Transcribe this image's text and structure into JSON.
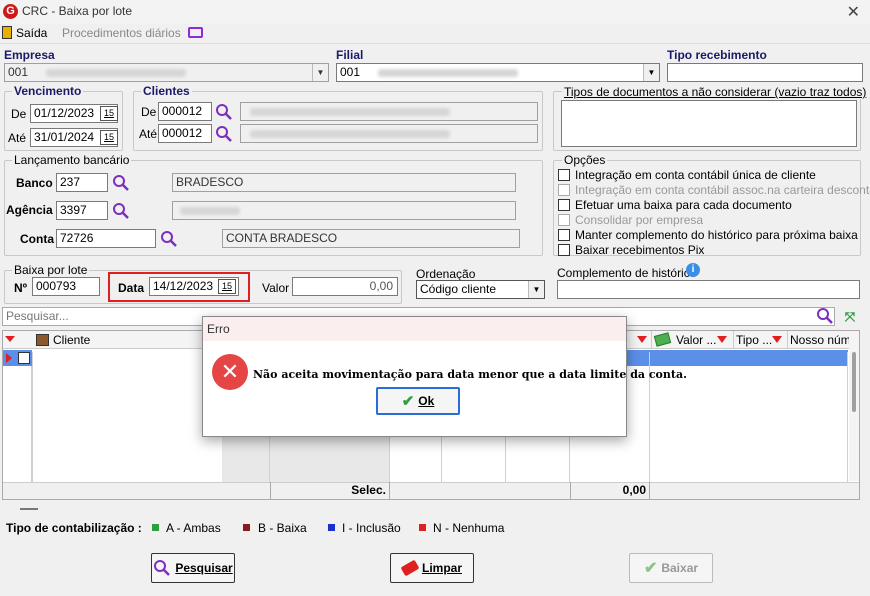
{
  "window": {
    "title": "CRC - Baixa por lote"
  },
  "toolbar": {
    "exit": "Saída",
    "daily": "Procedimentos diários"
  },
  "empresa": {
    "label": "Empresa",
    "value": "001"
  },
  "filial": {
    "label": "Filial",
    "value": "001"
  },
  "tipo_recebimento": {
    "label": "Tipo recebimento",
    "value": ""
  },
  "vencimento": {
    "title": "Vencimento",
    "de_label": "De",
    "de": "01/12/2023",
    "ate_label": "Até",
    "ate": "31/01/2024"
  },
  "clientes": {
    "title": "Clientes",
    "de_label": "De",
    "de": "000012",
    "ate_label": "Até",
    "ate": "000012"
  },
  "tipos_doc": {
    "title": "Tipos de documentos a não considerar (vazio traz todos)"
  },
  "lancamento": {
    "title": "Lançamento bancário",
    "banco_label": "Banco",
    "banco": "237",
    "banco_nome": "BRADESCO",
    "agencia_label": "Agência",
    "agencia": "3397",
    "conta_label": "Conta",
    "conta": "72726",
    "conta_nome": "CONTA BRADESCO"
  },
  "opcoes": {
    "title": "Opções",
    "items": [
      "Integração em conta contábil única de cliente",
      "Integração em conta contábil assoc.na carteira descontada",
      "Efetuar uma baixa para cada documento",
      "Consolidar por empresa",
      "Manter complemento do histórico para próxima baixa",
      "Baixar recebimentos Pix"
    ]
  },
  "baixa": {
    "title": "Baixa por lote",
    "num_label": "Nº",
    "num": "000793",
    "data_label": "Data",
    "data": "14/12/2023",
    "valor_label": "Valor",
    "valor": "0,00"
  },
  "ordenacao": {
    "title": "Ordenação",
    "value": "Código cliente"
  },
  "complemento": {
    "title": "Complemento de histórico",
    "value": ""
  },
  "search": {
    "placeholder": "Pesquisar..."
  },
  "grid": {
    "headers": {
      "cliente": "Cliente",
      "valor": "Valor ...",
      "tipo": "Tipo ...",
      "nosso": "Nosso núm"
    },
    "footer_selec": "Selec.",
    "footer_total": "0,00"
  },
  "legend": {
    "title": "Tipo de contabilização :",
    "items": [
      {
        "label": "A - Ambas",
        "color": "#2e9e3e"
      },
      {
        "label": "B - Baixa",
        "color": "#8b1a1a"
      },
      {
        "label": "I - Inclusão",
        "color": "#1a2fd0"
      },
      {
        "label": "N - Nenhuma",
        "color": "#e02020"
      }
    ]
  },
  "buttons": {
    "pesquisar": "Pesquisar",
    "limpar": "Limpar",
    "baixar": "Baixar"
  },
  "dialog": {
    "title": "Erro",
    "message": "Não aceita movimentação para data menor que a data limite da conta.",
    "ok": "Ok"
  },
  "colors": {
    "accent": "#7b2fbe",
    "highlight": "#e02020",
    "selected_row": "#5b8fe8"
  }
}
